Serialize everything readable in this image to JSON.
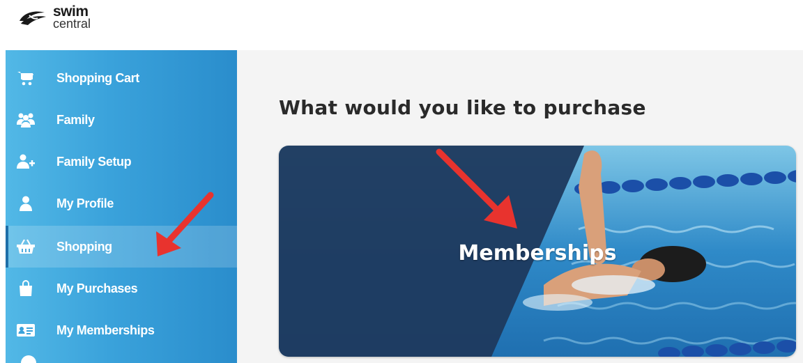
{
  "brand": {
    "line1": "swim",
    "line2": "central"
  },
  "sidebar": {
    "items": [
      {
        "label": "Shopping Cart",
        "icon": "shopping-cart-icon",
        "active": false
      },
      {
        "label": "Family",
        "icon": "family-icon",
        "active": false
      },
      {
        "label": "Family Setup",
        "icon": "add-user-icon",
        "active": false
      },
      {
        "label": "My Profile",
        "icon": "user-icon",
        "active": false
      },
      {
        "label": "Shopping",
        "icon": "basket-icon",
        "active": true
      },
      {
        "label": "My Purchases",
        "icon": "bag-icon",
        "active": false
      },
      {
        "label": "My Memberships",
        "icon": "id-card-icon",
        "active": false
      }
    ]
  },
  "main": {
    "title": "What would you like to purchase",
    "cards": [
      {
        "title": "Memberships",
        "image": "swimmer-photo"
      }
    ]
  },
  "colors": {
    "sidebar": "#3aa2db",
    "card_overlay": "#1e3a5f",
    "annotation_arrow": "#e8332e",
    "content_bg": "#f4f4f4"
  }
}
